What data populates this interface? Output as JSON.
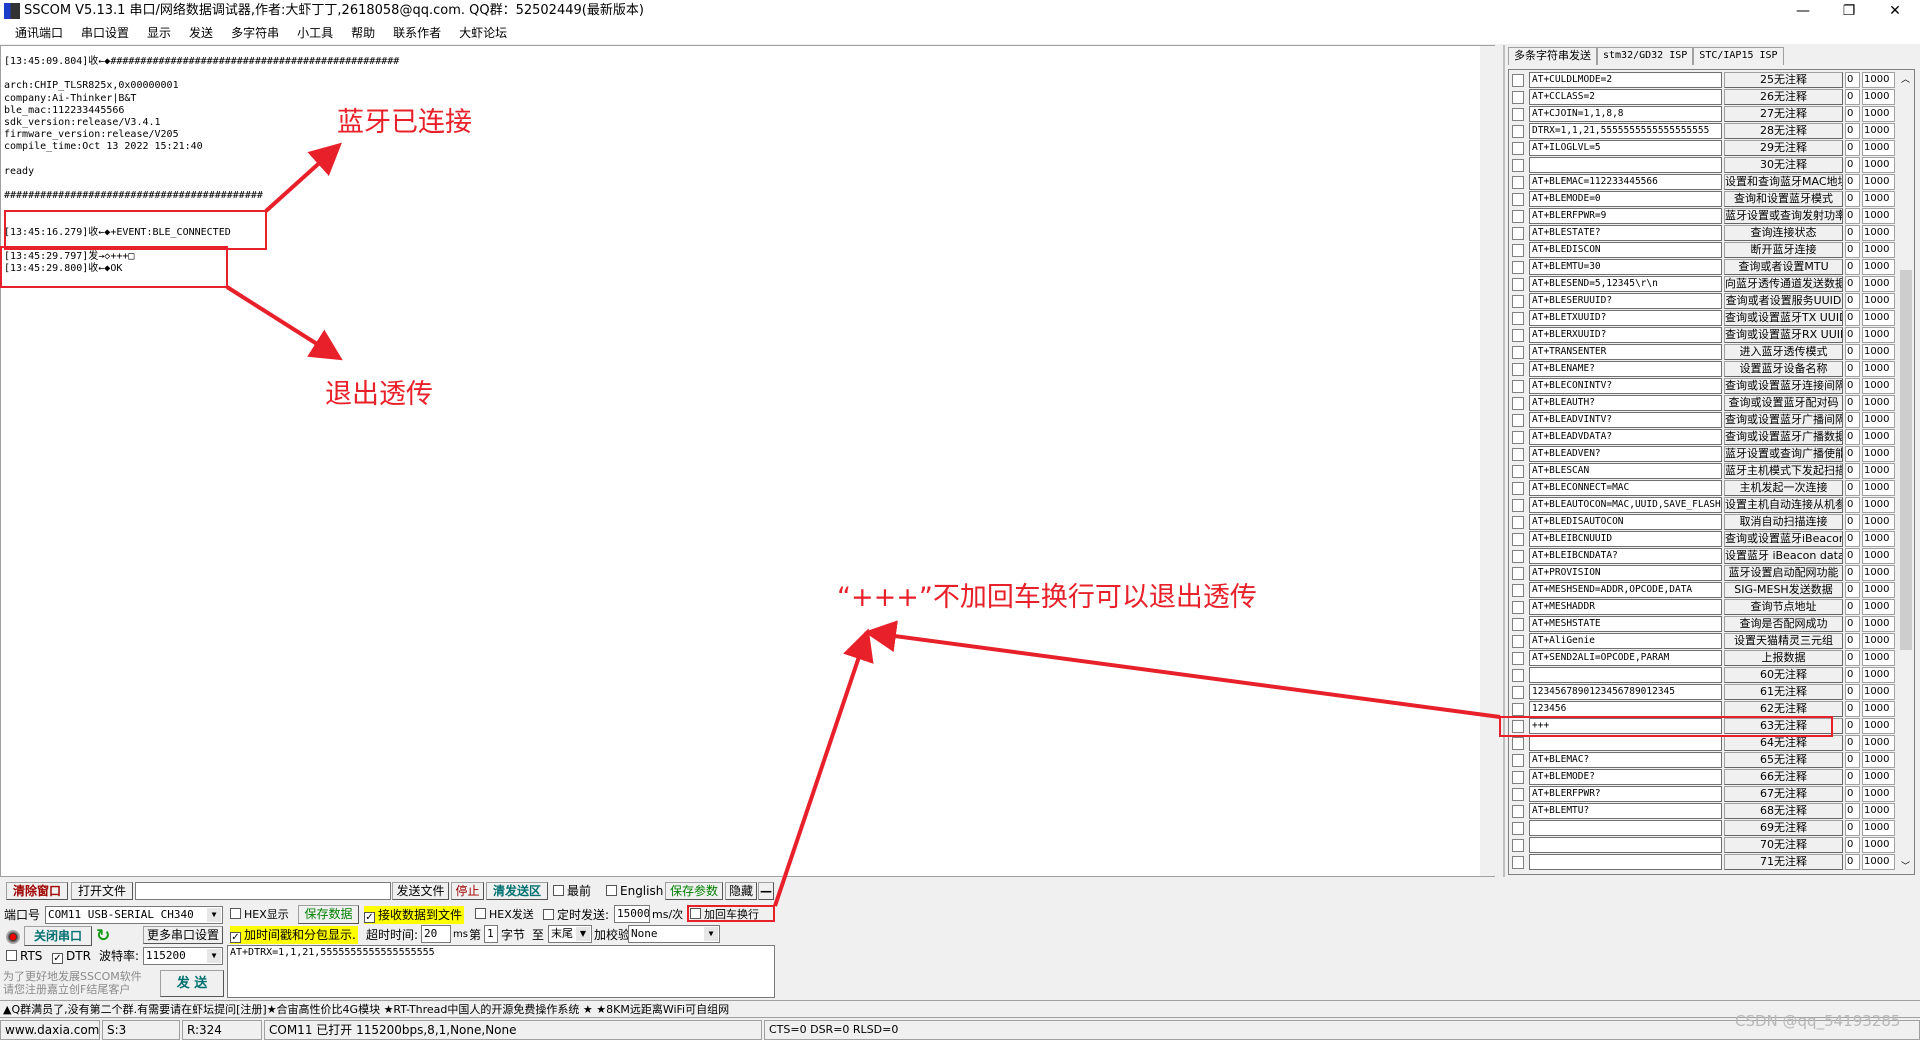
{
  "window": {
    "title": "SSCOM V5.13.1 串口/网络数据调试器,作者:大虾丁丁,2618058@qq.com. QQ群：52502449(最新版本)",
    "minimize": "—",
    "restore": "❐",
    "close": "✕"
  },
  "menu": [
    "通讯端口",
    "串口设置",
    "显示",
    "发送",
    "多字符串",
    "小工具",
    "帮助",
    "联系作者",
    "大虾论坛"
  ],
  "receive_log": "[13:45:09.804]收←◆################################################\n\narch:CHIP_TLSR825x,0x00000001\ncompany:Ai-Thinker|B&T\nble_mac:112233445566\nsdk_version:release/V3.4.1\nfirmware_version:release/V205\ncompile_time:Oct 13 2022 15:21:40\n\nready\n\n###########################################\n\n\n[13:45:16.279]收←◆+EVENT:BLE_CONNECTED\n\n[13:45:29.797]发→◇+++□\n[13:45:29.800]收←◆OK",
  "tabs": [
    "多条字符串发送",
    "stm32/GD32 ISP",
    "STC/IAP15 ISP"
  ],
  "multi_strings": [
    [
      "AT+CULDLMODE=2",
      "25无注释"
    ],
    [
      "AT+CCLASS=2",
      "26无注释"
    ],
    [
      "AT+CJOIN=1,1,8,8",
      "27无注释"
    ],
    [
      "DTRX=1,1,21,5555555555555555555",
      "28无注释"
    ],
    [
      "AT+ILOGLVL=5",
      "29无注释"
    ],
    [
      "",
      "30无注释"
    ],
    [
      "AT+BLEMAC=112233445566",
      "设置和查询蓝牙MAC地址"
    ],
    [
      "AT+BLEMODE=0",
      "查询和设置蓝牙模式"
    ],
    [
      "AT+BLERFPWR=9",
      "蓝牙设置或查询发射功率"
    ],
    [
      "AT+BLESTATE?",
      "查询连接状态"
    ],
    [
      "AT+BLEDISCON",
      "断开蓝牙连接"
    ],
    [
      "AT+BLEMTU=30",
      "查询或者设置MTU"
    ],
    [
      "AT+BLESEND=5,12345\\r\\n",
      "向蓝牙透传通道发送数据"
    ],
    [
      "AT+BLESERUUID?",
      "查询或者设置服务UUID"
    ],
    [
      "AT+BLETXUUID?",
      "查询或设置蓝牙TX UUID"
    ],
    [
      "AT+BLERXUUID?",
      "查询或设置蓝牙RX UUID"
    ],
    [
      "AT+TRANSENTER",
      "进入蓝牙透传模式"
    ],
    [
      "AT+BLENAME?",
      "设置蓝牙设备名称"
    ],
    [
      "AT+BLECONINTV?",
      "查询或设置蓝牙连接间隔"
    ],
    [
      "AT+BLEAUTH?",
      "查询或设置蓝牙配对码"
    ],
    [
      "AT+BLEADVINTV?",
      "查询或设置蓝牙广播间隔"
    ],
    [
      "AT+BLEADVDATA?",
      "查询或设置蓝牙广播数据"
    ],
    [
      "AT+BLEADVEN?",
      "蓝牙设置或查询广播使能"
    ],
    [
      "AT+BLESCAN",
      "蓝牙主机模式下发起扫描"
    ],
    [
      "AT+BLECONNECT=MAC",
      "主机发起一次连接"
    ],
    [
      "AT+BLEAUTOCON=MAC,UUID,SAVE_FLASH",
      "设置主机自动连接从机参数"
    ],
    [
      "AT+BLEDISAUTOCON",
      "取消自动扫描连接"
    ],
    [
      "AT+BLEIBCNUUID",
      "查询或设置蓝牙iBeacon UUID"
    ],
    [
      "AT+BLEIBCNDATA?",
      "设置蓝牙 iBeacon data"
    ],
    [
      "AT+PROVISION",
      "蓝牙设置启动配网功能"
    ],
    [
      "AT+MESHSEND=ADDR,OPCODE,DATA",
      "SIG-MESH发送数据"
    ],
    [
      "AT+MESHADDR",
      "查询节点地址"
    ],
    [
      "AT+MESHSTATE",
      "查询是否配网成功"
    ],
    [
      "AT+AliGenie",
      "设置天猫精灵三元组"
    ],
    [
      "AT+SEND2ALI=OPCODE,PARAM",
      "上报数据"
    ],
    [
      "",
      "60无注释"
    ],
    [
      "1234567890123456789012345",
      "61无注释"
    ],
    [
      "123456",
      "62无注释"
    ],
    [
      "+++",
      "63无注释"
    ],
    [
      "",
      "64无注释"
    ],
    [
      "AT+BLEMAC?",
      "65无注释"
    ],
    [
      "AT+BLEMODE?",
      "66无注释"
    ],
    [
      "AT+BLERFPWR?",
      "67无注释"
    ],
    [
      "AT+BLEMTU?",
      "68无注释"
    ],
    [
      "",
      "69无注释"
    ],
    [
      "",
      "70无注释"
    ],
    [
      "",
      "71无注释"
    ]
  ],
  "row_order": "0",
  "row_delay": "1000",
  "toolbar": {
    "clear": "清除窗口",
    "open_file": "打开文件",
    "file_path": "",
    "send_file": "发送文件",
    "stop": "停止",
    "clear_send": "清发送区",
    "topmost": "最前",
    "english": "English",
    "save_params": "保存参数",
    "hide": "隐藏",
    "dash": "—"
  },
  "port": {
    "label": "端口号",
    "value": "COM11 USB-SERIAL CH340",
    "close_port": "关闭串口",
    "more_settings": "更多串口设置",
    "rts": "RTS",
    "dtr": "DTR",
    "baud_label": "波特率:",
    "baud": "115200"
  },
  "options": {
    "hex_display": "HEX显示",
    "save_data": "保存数据",
    "recv_to_file": "接收数据到文件",
    "hex_send": "HEX发送",
    "timed_send": "定时发送:",
    "interval": "15000",
    "interval_unit": "ms/次",
    "add_crlf": "加回车换行",
    "timestamp": "加时间戳和分包显示.",
    "timeout_label": "超时时间:",
    "timeout": "20",
    "timeout_unit": "ms",
    "nth": "第",
    "byte_from": "1",
    "byte_label": "字节",
    "to": "至",
    "end": "末尾",
    "checksum_label": "加校验",
    "checksum": "None"
  },
  "send_text": "AT+DTRX=1,1,21,5555555555555555555",
  "send_button": "发 送",
  "promo": "为了更好地发展SSCOM软件\n请您注册嘉立创F结尾客户",
  "ticker": "▲Q群满员了,没有第二个群.有需要请在虾坛提问[注册]★合宙高性价比4G模块 ★RT-Thread中国人的开源免费操作系统 ★ ★8KM远距离WiFi可自组网",
  "status": {
    "site": "www.daxia.com",
    "sent": "S:3",
    "recv": "R:324",
    "port": "COM11 已打开  115200bps,8,1,None,None",
    "lines": "CTS=0 DSR=0 RLSD=0"
  },
  "watermark": "CSDN @qq_54193285",
  "annotations": {
    "connected": "蓝牙已连接",
    "exit": "退出透传",
    "note": "“+++”不加回车换行可以退出透传"
  },
  "colors": {
    "annotation": "#e8202a",
    "highlight": "#ffff00"
  }
}
